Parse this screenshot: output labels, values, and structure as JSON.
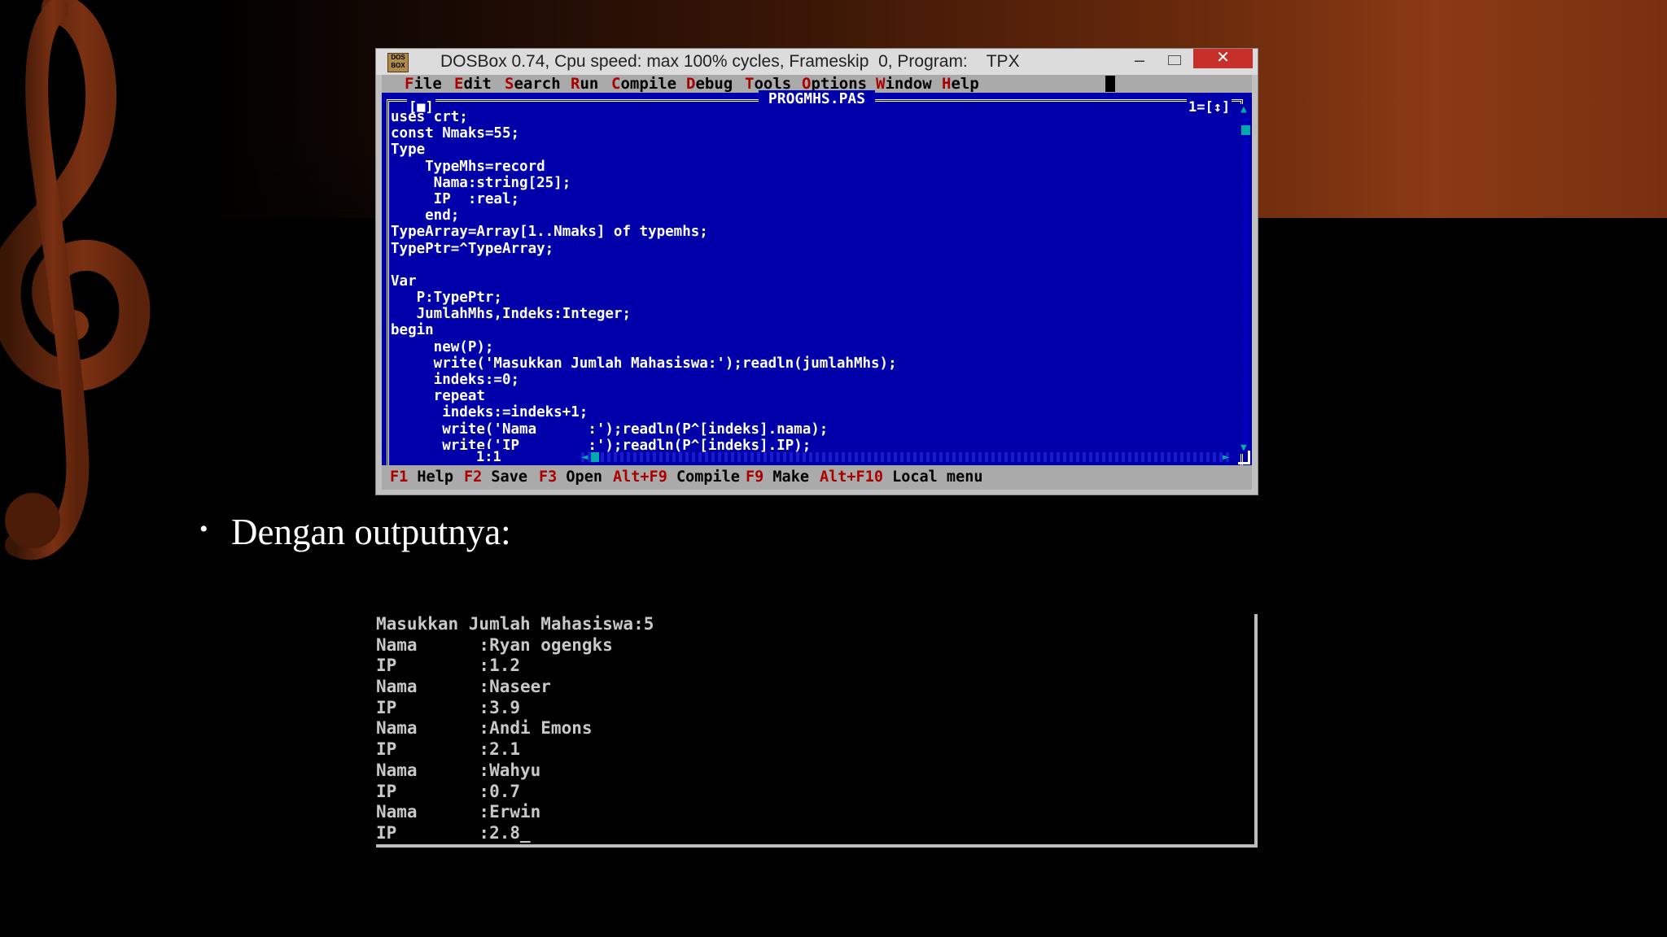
{
  "window": {
    "title": "DOSBox 0.74, Cpu speed: max 100% cycles, Frameskip  0, Program:    TPX",
    "icon_label": "DOS BOX",
    "minimize_glyph": "–",
    "close_glyph": "✕"
  },
  "menu": [
    {
      "hotkey": "F",
      "rest": "ile"
    },
    {
      "hotkey": "E",
      "rest": "dit"
    },
    {
      "hotkey": "S",
      "rest": "earch"
    },
    {
      "hotkey": "R",
      "rest": "un"
    },
    {
      "hotkey": "C",
      "rest": "ompile"
    },
    {
      "hotkey": "D",
      "rest": "ebug"
    },
    {
      "hotkey": "T",
      "rest": "ools"
    },
    {
      "hotkey": "O",
      "rest": "ptions"
    },
    {
      "hotkey": "W",
      "rest": "indow"
    },
    {
      "hotkey": "H",
      "rest": "elp"
    }
  ],
  "editor": {
    "filename": "PROGMHS.PAS",
    "close_box": "[■]",
    "window_number": "1=[↕]",
    "cursor_position": "1:1",
    "code_lines": [
      "uses crt;",
      "const Nmaks=55;",
      "Type",
      "    TypeMhs=record",
      "     Nama:string[25];",
      "     IP  :real;",
      "    end;",
      "TypeArray=Array[1..Nmaks] of typemhs;",
      "TypePtr=^TypeArray;",
      "",
      "Var",
      "   P:TypePtr;",
      "   JumlahMhs,Indeks:Integer;",
      "begin",
      "     new(P);",
      "     write('Masukkan Jumlah Mahasiswa:');readln(jumlahMhs);",
      "     indeks:=0;",
      "     repeat",
      "      indeks:=indeks+1;",
      "      write('Nama      :');readln(P^[indeks].nama);",
      "      write('IP        :');readln(P^[indeks].IP);"
    ]
  },
  "function_keys": [
    {
      "key": "F1",
      "label": "Help"
    },
    {
      "key": "F2",
      "label": "Save"
    },
    {
      "key": "F3",
      "label": "Open"
    },
    {
      "key": "Alt+F9",
      "label": "Compile"
    },
    {
      "key": "F9",
      "label": "Make"
    },
    {
      "key": "Alt+F10",
      "label": "Local menu"
    }
  ],
  "slide": {
    "bullet": "•",
    "text": "Dengan outputnya:"
  },
  "output": {
    "lines": [
      "Masukkan Jumlah Mahasiswa:5",
      "Nama      :Ryan ogengks",
      "IP        :1.2",
      "Nama      :Naseer",
      "IP        :3.9",
      "Nama      :Andi Emons",
      "IP        :2.1",
      "Nama      :Wahyu",
      "IP        :0.7",
      "Nama      :Erwin",
      "IP        :2.8_"
    ]
  },
  "colors": {
    "editor_bg": "#0000aa",
    "menu_bg": "#aaaaaa",
    "hotkey": "#aa0000",
    "close_button": "#c7302a",
    "accent_gradient": "#8a3a14"
  }
}
